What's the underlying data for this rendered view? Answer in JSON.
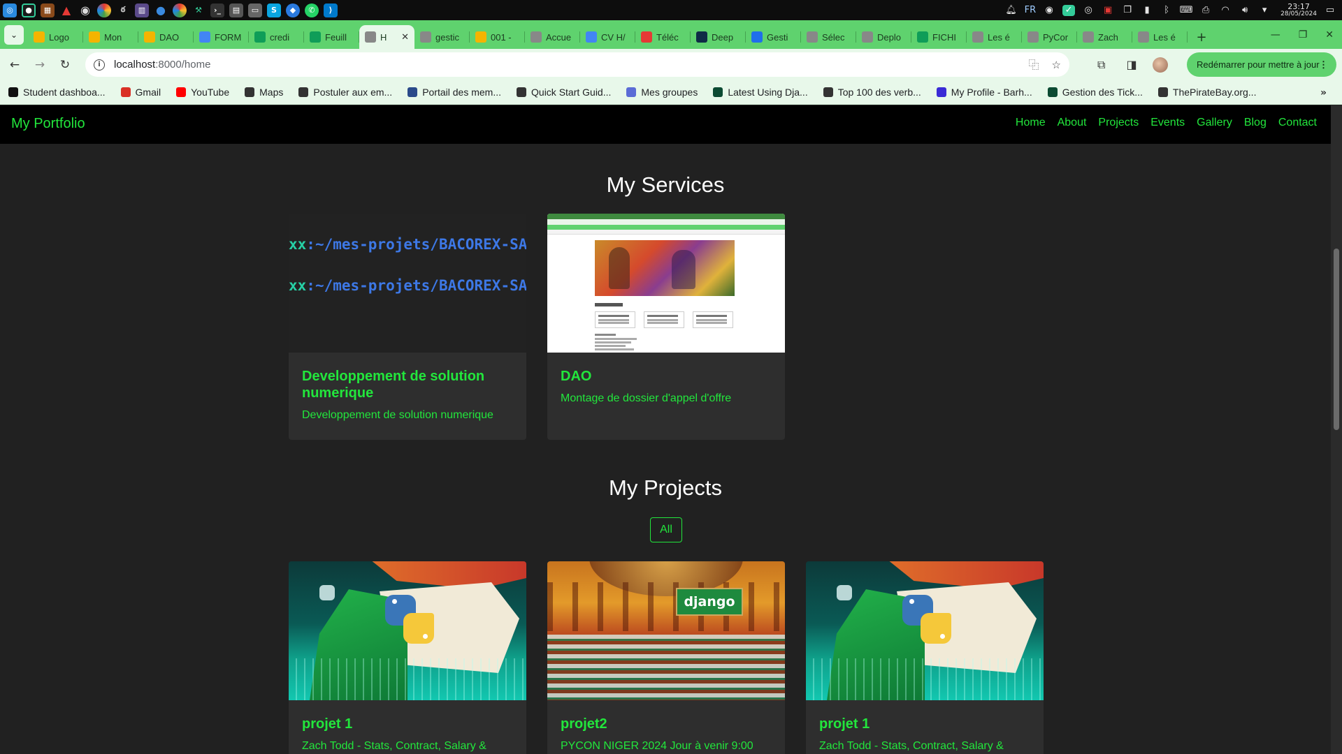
{
  "os": {
    "tray": {
      "lang": "FR",
      "time": "23:17",
      "date": "28/05/2024"
    }
  },
  "browser": {
    "tabs": [
      {
        "label": "Logo",
        "icon": "google-drive-icon",
        "color": "#f4b400"
      },
      {
        "label": "Mon",
        "icon": "google-drive-icon",
        "color": "#f4b400"
      },
      {
        "label": "DAO",
        "icon": "google-drive-icon",
        "color": "#f4b400"
      },
      {
        "label": "FORM",
        "icon": "google-docs-icon",
        "color": "#4285f4"
      },
      {
        "label": "credi",
        "icon": "google-sheets-icon",
        "color": "#0f9d58"
      },
      {
        "label": "Feuill",
        "icon": "google-sheets-icon",
        "color": "#0f9d58"
      },
      {
        "label": "H",
        "icon": "globe-icon",
        "color": "#888888",
        "active": true
      },
      {
        "label": "gestic",
        "icon": "globe-icon",
        "color": "#888888"
      },
      {
        "label": "001 -",
        "icon": "google-drive-icon",
        "color": "#f4b400"
      },
      {
        "label": "Accue",
        "icon": "globe-icon",
        "color": "#888888"
      },
      {
        "label": "CV H/",
        "icon": "google-docs-icon",
        "color": "#4285f4"
      },
      {
        "label": "Téléc",
        "icon": "heart-icon",
        "color": "#e53935"
      },
      {
        "label": "Deep",
        "icon": "deepl-icon",
        "color": "#0f2b46"
      },
      {
        "label": "Gesti",
        "icon": "link-icon",
        "color": "#1f6feb"
      },
      {
        "label": "Sélec",
        "icon": "globe-icon",
        "color": "#888888"
      },
      {
        "label": "Deplo",
        "icon": "globe-icon",
        "color": "#888888"
      },
      {
        "label": "FICHI",
        "icon": "google-sheets-icon",
        "color": "#0f9d58"
      },
      {
        "label": "Les é",
        "icon": "globe-icon",
        "color": "#888888"
      },
      {
        "label": "PyCor",
        "icon": "globe-icon",
        "color": "#888888"
      },
      {
        "label": "Zach",
        "icon": "globe-icon",
        "color": "#888888"
      },
      {
        "label": "Les é",
        "icon": "globe-icon",
        "color": "#888888"
      }
    ],
    "url_host": "localhost",
    "url_path": ":8000/home",
    "update_label": "Redémarrer pour mettre à jour",
    "bookmarks": [
      {
        "label": "Student dashboa...",
        "icon": "alx-icon",
        "color": "#111111"
      },
      {
        "label": "Gmail",
        "icon": "gmail-icon",
        "color": "#d93025"
      },
      {
        "label": "YouTube",
        "icon": "youtube-icon",
        "color": "#ff0000"
      },
      {
        "label": "Maps",
        "icon": "globe-icon",
        "color": "#333333"
      },
      {
        "label": "Postuler aux em...",
        "icon": "globe-icon",
        "color": "#333333"
      },
      {
        "label": "Portail des mem...",
        "icon": "portal-icon",
        "color": "#2a4a8a"
      },
      {
        "label": "Quick Start Guid...",
        "icon": "globe-icon",
        "color": "#333333"
      },
      {
        "label": "Mes groupes",
        "icon": "groups-icon",
        "color": "#5b6cd6"
      },
      {
        "label": "Latest Using Dja...",
        "icon": "django-icon",
        "color": "#0c4b33"
      },
      {
        "label": "Top 100 des verb...",
        "icon": "globe-icon",
        "color": "#333333"
      },
      {
        "label": "My Profile - Barh...",
        "icon": "profile-icon",
        "color": "#3a2bd6"
      },
      {
        "label": "Gestion des Tick...",
        "icon": "django-icon",
        "color": "#0c4b33"
      },
      {
        "label": "ThePirateBay.org...",
        "icon": "globe-icon",
        "color": "#333333"
      }
    ]
  },
  "site": {
    "brand": "My Portfolio",
    "nav": [
      "Home",
      "About",
      "Projects",
      "Events",
      "Gallery",
      "Blog",
      "Contact"
    ],
    "services_title": "My Services",
    "services": [
      {
        "title": "Developpement de solution numerique",
        "desc": "Developpement de solution numerique",
        "terminal": {
          "user": "xx",
          "path": ":~/mes-projets/BACOREX-SA"
        }
      },
      {
        "title": "DAO",
        "desc": "Montage de dossier d'appel d'offre"
      }
    ],
    "projects_title": "My Projects",
    "filter_all": "All",
    "projects": [
      {
        "title": "projet 1",
        "desc": "Zach Todd - Stats, Contract, Salary & More"
      },
      {
        "title": "projet2",
        "desc": "PYCON NIGER 2024 Jour à venir 9:00 AM",
        "badge": "django"
      },
      {
        "title": "projet 1",
        "desc": "Zach Todd - Stats, Contract, Salary & More"
      }
    ],
    "accent": "#22e63c"
  }
}
